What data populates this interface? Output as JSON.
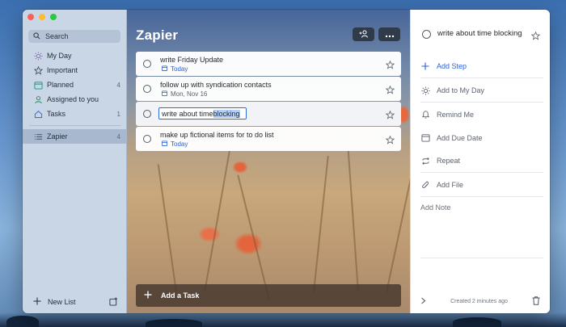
{
  "sidebar": {
    "search_label": "Search",
    "items": [
      {
        "label": "My Day",
        "count": ""
      },
      {
        "label": "Important",
        "count": ""
      },
      {
        "label": "Planned",
        "count": "4"
      },
      {
        "label": "Assigned to you",
        "count": ""
      },
      {
        "label": "Tasks",
        "count": "1"
      }
    ],
    "lists": [
      {
        "label": "Zapier",
        "count": "4"
      }
    ],
    "new_list_label": "New List"
  },
  "main": {
    "title": "Zapier",
    "tasks": [
      {
        "name": "write Friday Update",
        "due": "Today"
      },
      {
        "name": "follow up with syndication contacts",
        "due": "Mon, Nov 16"
      },
      {
        "name_prefix": "write about time ",
        "name_selected": "blocking"
      },
      {
        "name": "make up fictional items for to do list",
        "due": "Today"
      }
    ],
    "add_task_label": "Add a Task"
  },
  "detail": {
    "title": "write about time blocking",
    "add_step_label": "Add Step",
    "add_to_my_day_label": "Add to My Day",
    "remind_me_label": "Remind Me",
    "add_due_date_label": "Add Due Date",
    "repeat_label": "Repeat",
    "add_file_label": "Add File",
    "add_note_label": "Add Note",
    "created_text": "Created 2 minutes ago"
  },
  "colors": {
    "accent_blue": "#2b61d6",
    "sidebar_bg": "#c9d6e6",
    "header_button_bg": "#2f3b4b"
  }
}
